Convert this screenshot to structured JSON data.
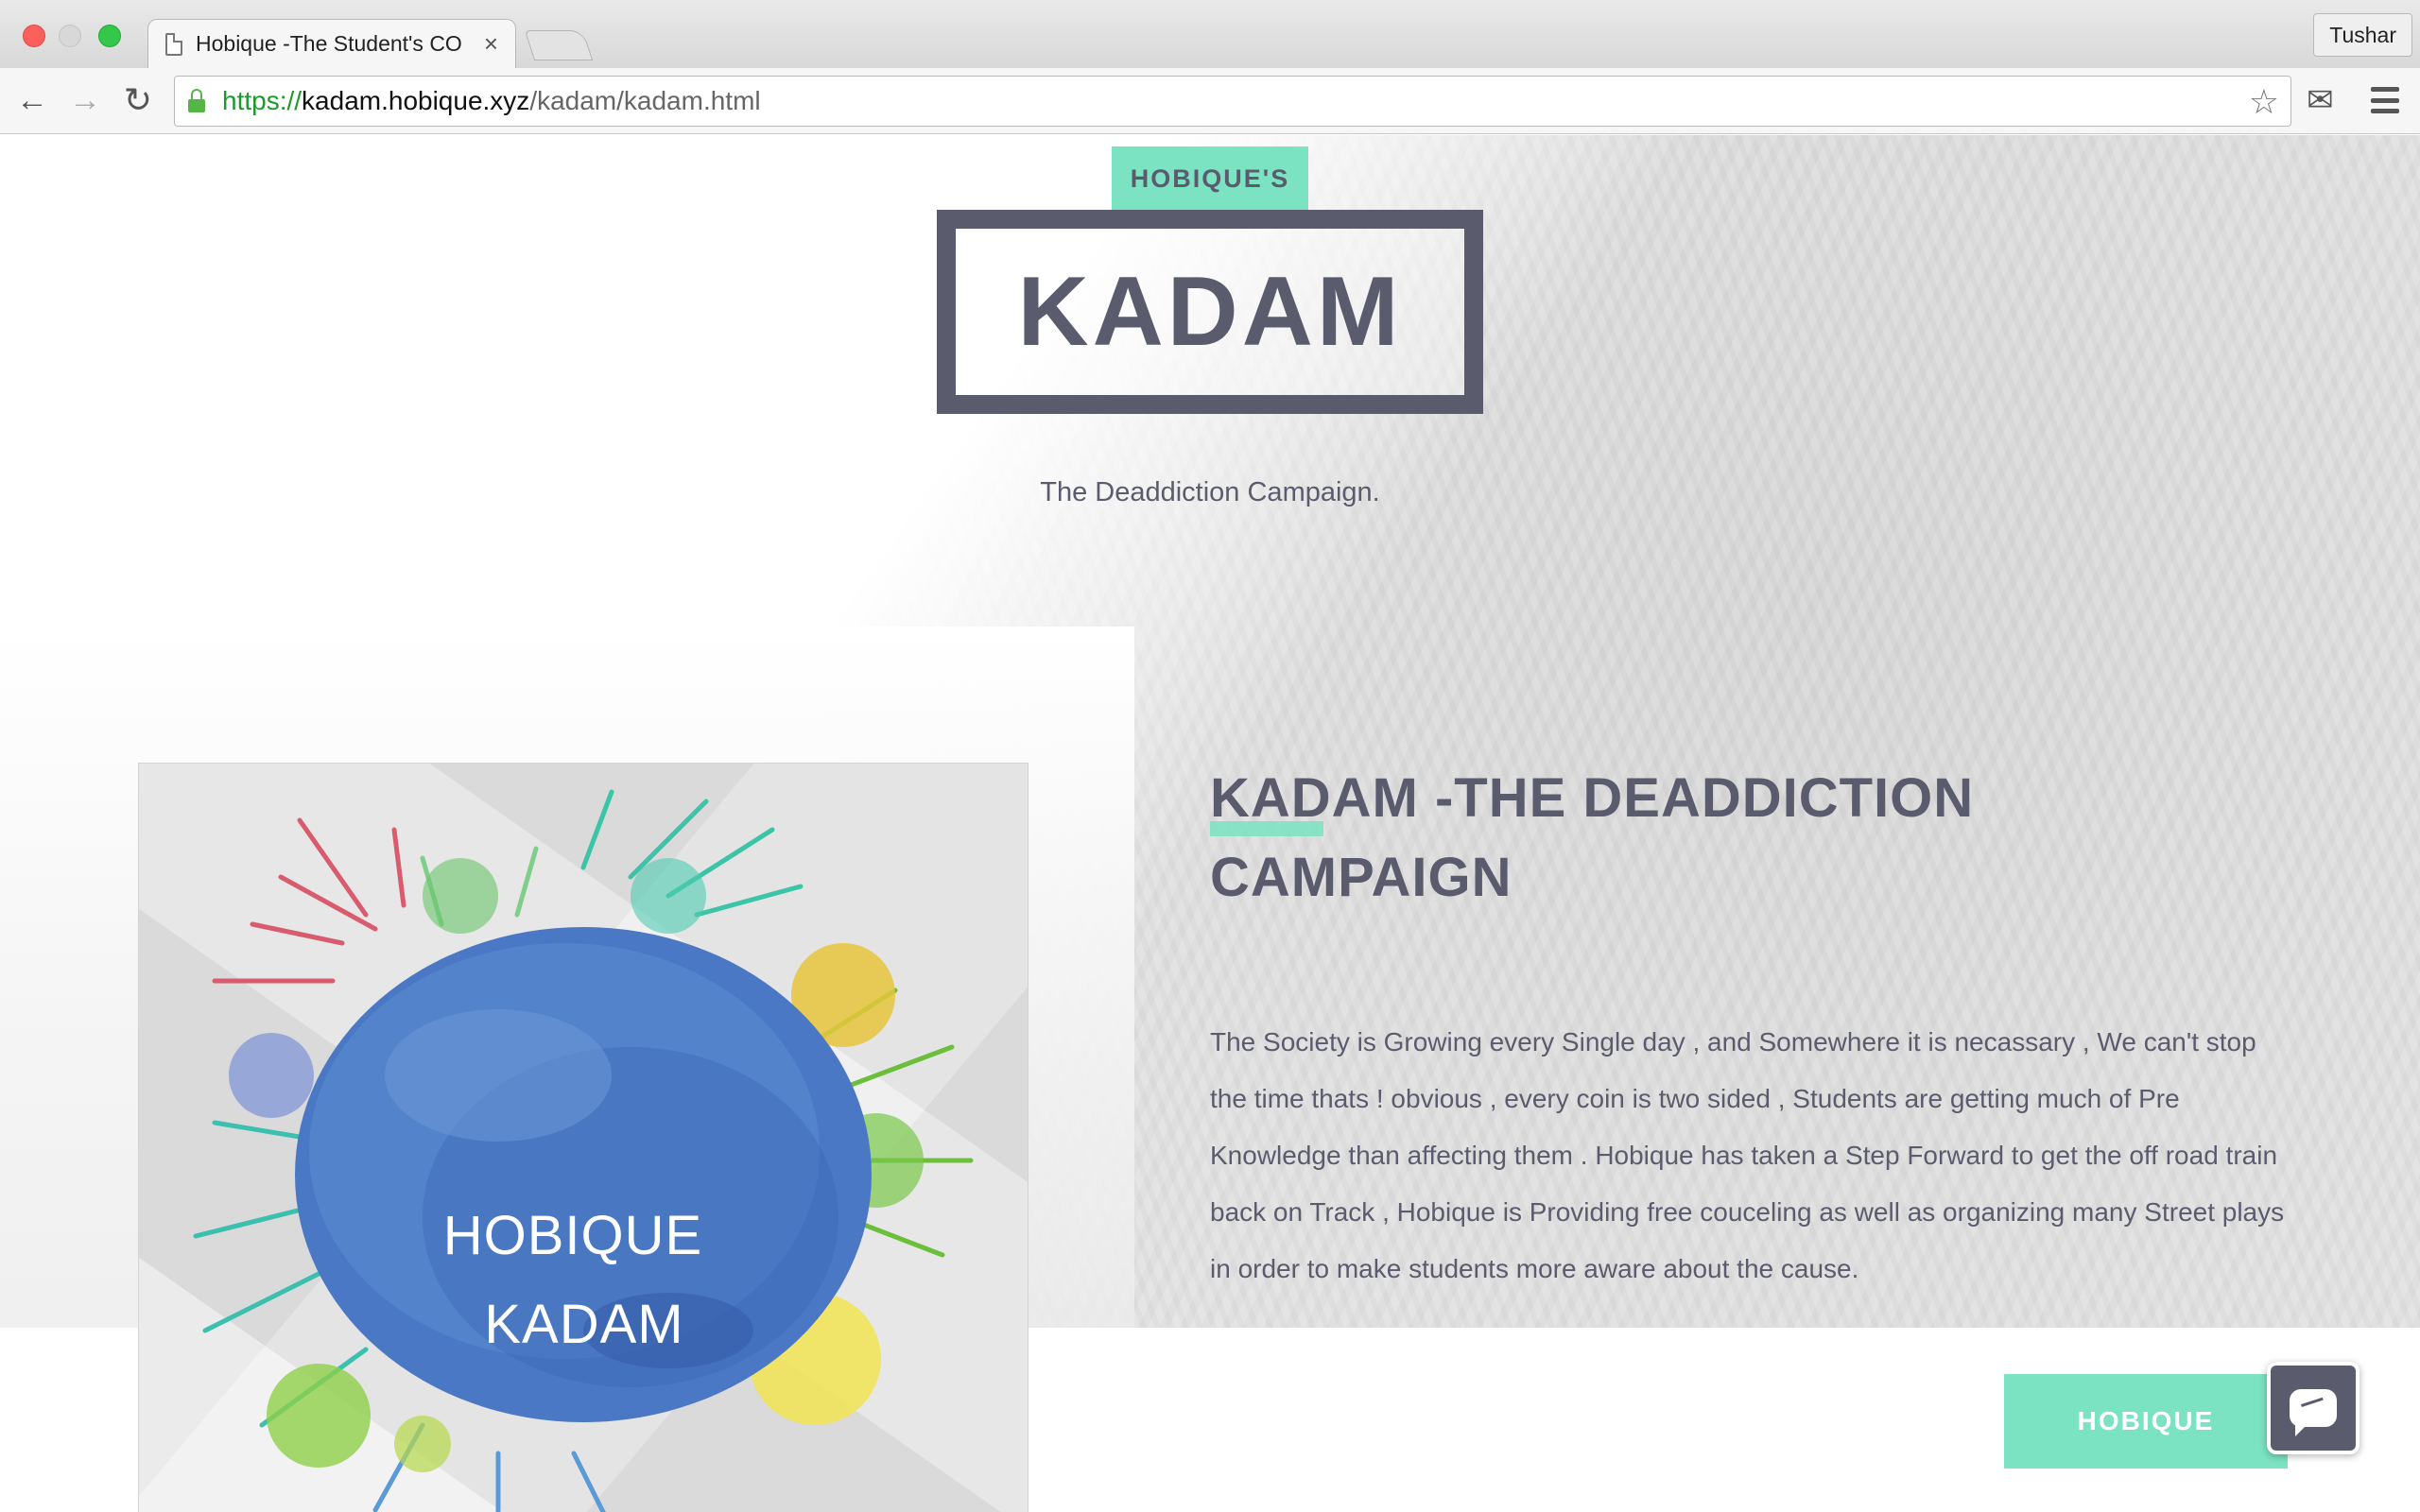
{
  "browser": {
    "tab_title": "Hobique -The Student's CO",
    "tab_close": "×",
    "profile_name": "Tushar",
    "url_scheme": "https://",
    "url_host": "kadam.hobique.xyz",
    "url_path": "/kadam/kadam.html"
  },
  "hero": {
    "tag": "HOBIQUE'S",
    "logo": "KADAM",
    "subtitle": "The Deaddiction Campaign."
  },
  "feature": {
    "image_line1": "HOBIQUE",
    "image_line2": "KADAM",
    "heading": "KADAM -THE DEADDICTION CAMPAIGN",
    "body": "The Society is Growing every Single day , and Somewhere it is necassary , We can't stop the time thats ! obvious , every coin is two sided , Students are getting much of Pre Knowledge than affecting them . Hobique has taken a Step Forward to get the off road train back on Track , Hobique is Providing free couceling as well as organizing many Street plays in order to make students more aware about the cause.",
    "cta": "HOBIQUE"
  },
  "colors": {
    "accent": "#7be3c2",
    "text": "#5b5b6e",
    "watercolor_blue": "#4a78c4"
  },
  "icons": {
    "page": "document-icon",
    "secure": "lock-icon",
    "bookmark": "star-icon",
    "extension": "mail-icon",
    "menu": "hamburger-menu-icon",
    "chat": "chat-bubble-icon"
  }
}
